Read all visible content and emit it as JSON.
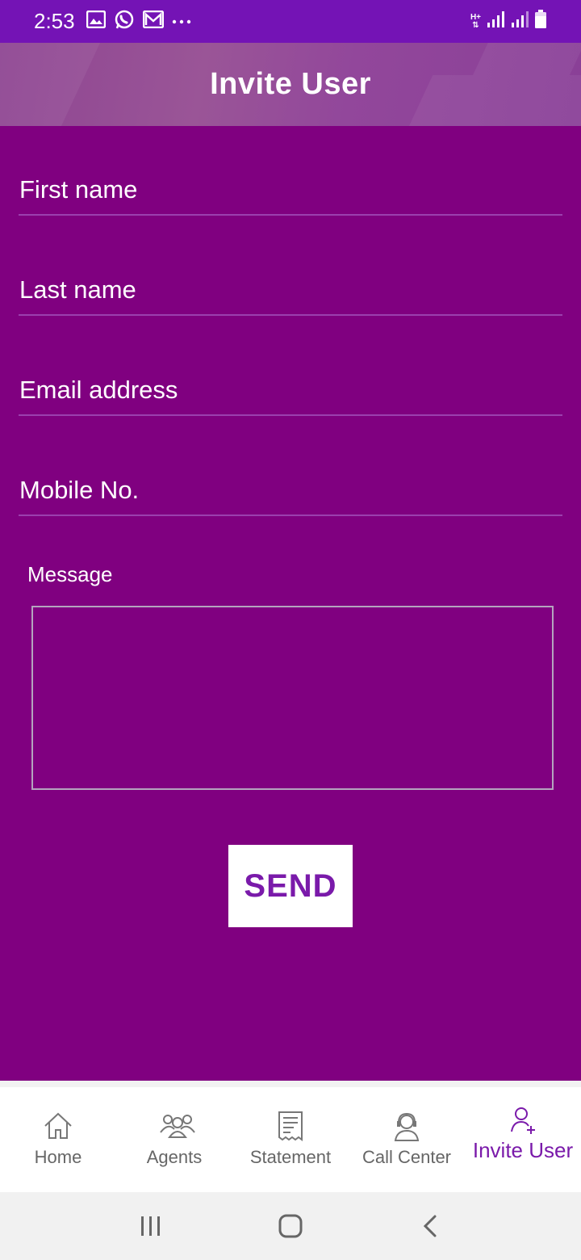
{
  "status_bar": {
    "time": "2:53",
    "icons_left": [
      "gallery-icon",
      "whatsapp-icon",
      "gmail-icon",
      "more-dots-icon"
    ],
    "icons_right": [
      "hplus-network-icon",
      "signal-icon",
      "signal-icon-2",
      "battery-icon"
    ],
    "network_label": "H+"
  },
  "header": {
    "title": "Invite User"
  },
  "form": {
    "first_name": {
      "placeholder": "First name",
      "value": ""
    },
    "last_name": {
      "placeholder": "Last name",
      "value": ""
    },
    "email": {
      "placeholder": "Email address",
      "value": ""
    },
    "mobile": {
      "placeholder": "Mobile No.",
      "value": ""
    },
    "message_label": "Message",
    "message_value": "",
    "send_label": "SEND"
  },
  "bottom_nav": {
    "items": [
      {
        "label": "Home",
        "icon": "home-icon",
        "active": false
      },
      {
        "label": "Agents",
        "icon": "agents-icon",
        "active": false
      },
      {
        "label": "Statement",
        "icon": "statement-icon",
        "active": false
      },
      {
        "label": "Call Center",
        "icon": "call-center-icon",
        "active": false
      },
      {
        "label": "Invite User",
        "icon": "invite-user-icon",
        "active": true
      }
    ]
  },
  "system_nav": {
    "buttons": [
      "recent-apps-icon",
      "home-button-icon",
      "back-icon"
    ]
  },
  "colors": {
    "status_bar": "#7413b5",
    "background": "#800080",
    "accent": "#7a1aaa",
    "nav_inactive": "#666666"
  }
}
